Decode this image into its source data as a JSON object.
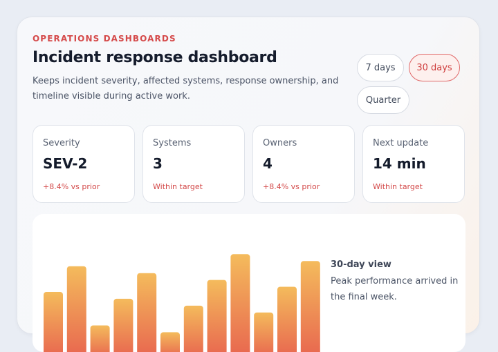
{
  "header": {
    "eyebrow": "OPERATIONS DASHBOARDS",
    "title": "Incident response dashboard",
    "description": "Keeps incident severity, affected systems, response ownership, and timeline visible during active work."
  },
  "range": {
    "options": [
      "7 days",
      "30 days",
      "Quarter"
    ],
    "selected": "30 days"
  },
  "kpis": [
    {
      "label": "Severity",
      "value": "SEV-2",
      "delta": "+8.4% vs prior"
    },
    {
      "label": "Systems",
      "value": "3",
      "delta": "Within target"
    },
    {
      "label": "Owners",
      "value": "4",
      "delta": "+8.4% vs prior"
    },
    {
      "label": "Next update",
      "value": "14 min",
      "delta": "Within target"
    }
  ],
  "chart_caption": {
    "title": "30-day view",
    "text": "Peak performance arrived in the final week."
  },
  "colors": {
    "accent": "#d54a4a",
    "bar_top": "#f4bb5c",
    "bar_bottom": "#e8664f"
  },
  "chart_data": {
    "type": "bar",
    "values": [
      70,
      100,
      31,
      62,
      92,
      23,
      54,
      84,
      114,
      46,
      76,
      106
    ],
    "ylim": [
      0,
      140
    ]
  }
}
